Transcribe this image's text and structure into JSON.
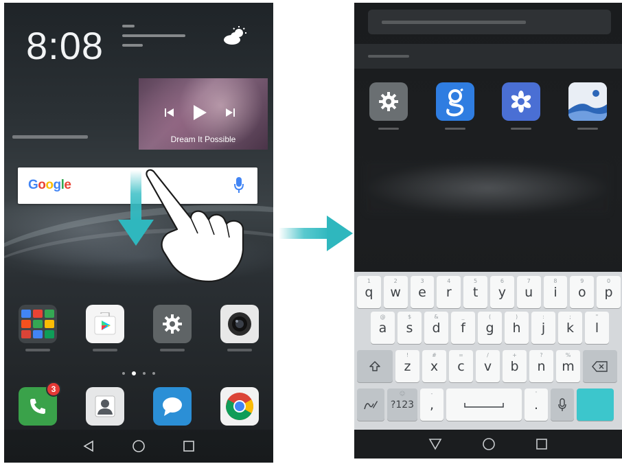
{
  "left_screen": {
    "clock_time": "8:08",
    "music_title": "Dream It Possible",
    "google_logo": {
      "G": "G",
      "o1": "o",
      "o2": "o",
      "g": "g",
      "l": "l",
      "e": "e"
    },
    "notification_badge": "3"
  },
  "right_screen": {
    "keyboard": {
      "row1": [
        {
          "label": "q",
          "hint": "1"
        },
        {
          "label": "w",
          "hint": "2"
        },
        {
          "label": "e",
          "hint": "3"
        },
        {
          "label": "r",
          "hint": "4"
        },
        {
          "label": "t",
          "hint": "5"
        },
        {
          "label": "y",
          "hint": "6"
        },
        {
          "label": "u",
          "hint": "7"
        },
        {
          "label": "i",
          "hint": "8"
        },
        {
          "label": "o",
          "hint": "9"
        },
        {
          "label": "p",
          "hint": "0"
        }
      ],
      "row2": [
        {
          "label": "a",
          "hint": "@"
        },
        {
          "label": "s",
          "hint": "$"
        },
        {
          "label": "d",
          "hint": "&"
        },
        {
          "label": "f",
          "hint": "_"
        },
        {
          "label": "g",
          "hint": "("
        },
        {
          "label": "h",
          "hint": ")"
        },
        {
          "label": "j",
          "hint": ":"
        },
        {
          "label": "k",
          "hint": ";"
        },
        {
          "label": "l",
          "hint": "\""
        }
      ],
      "row3": [
        {
          "label": "z",
          "hint": "!"
        },
        {
          "label": "x",
          "hint": "#"
        },
        {
          "label": "c",
          "hint": "="
        },
        {
          "label": "v",
          "hint": "/"
        },
        {
          "label": "b",
          "hint": "+"
        },
        {
          "label": "n",
          "hint": "?"
        },
        {
          "label": "m",
          "hint": "%"
        }
      ],
      "symbols_key": "?123",
      "comma_key": ",",
      "period_key": "."
    }
  },
  "colors": {
    "arrow_teal": "#3bbfc6",
    "keyboard_action_key": "#3cc6cc",
    "badge_red": "#e53935"
  }
}
